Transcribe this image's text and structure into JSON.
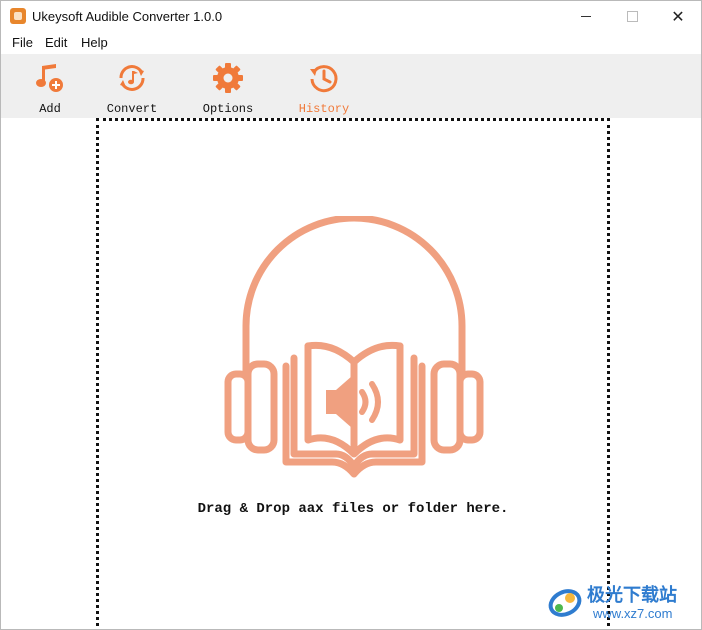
{
  "window": {
    "title": "Ukeysoft Audible Converter 1.0.0",
    "controls": {
      "minimize": "minimize",
      "maximize": "maximize",
      "close": "✕"
    }
  },
  "menu": {
    "file": "File",
    "edit": "Edit",
    "help": "Help"
  },
  "toolbar": {
    "add": {
      "label": "Add",
      "icon": "music-add-icon"
    },
    "convert": {
      "label": "Convert",
      "icon": "music-convert-icon"
    },
    "options": {
      "label": "Options",
      "icon": "gear-icon"
    },
    "history": {
      "label": "History",
      "icon": "history-clock-icon",
      "active": true
    }
  },
  "dropzone": {
    "message": "Drag & Drop aax files or folder here.",
    "icon": "headphones-audiobook-icon"
  },
  "watermark": {
    "title": "极光下载站",
    "url": "www.xz7.com"
  },
  "colors": {
    "accent": "#f07a3a",
    "hero": "#f0a080",
    "toolbar_bg": "#efefef",
    "watermark": "#2f7ccf"
  }
}
